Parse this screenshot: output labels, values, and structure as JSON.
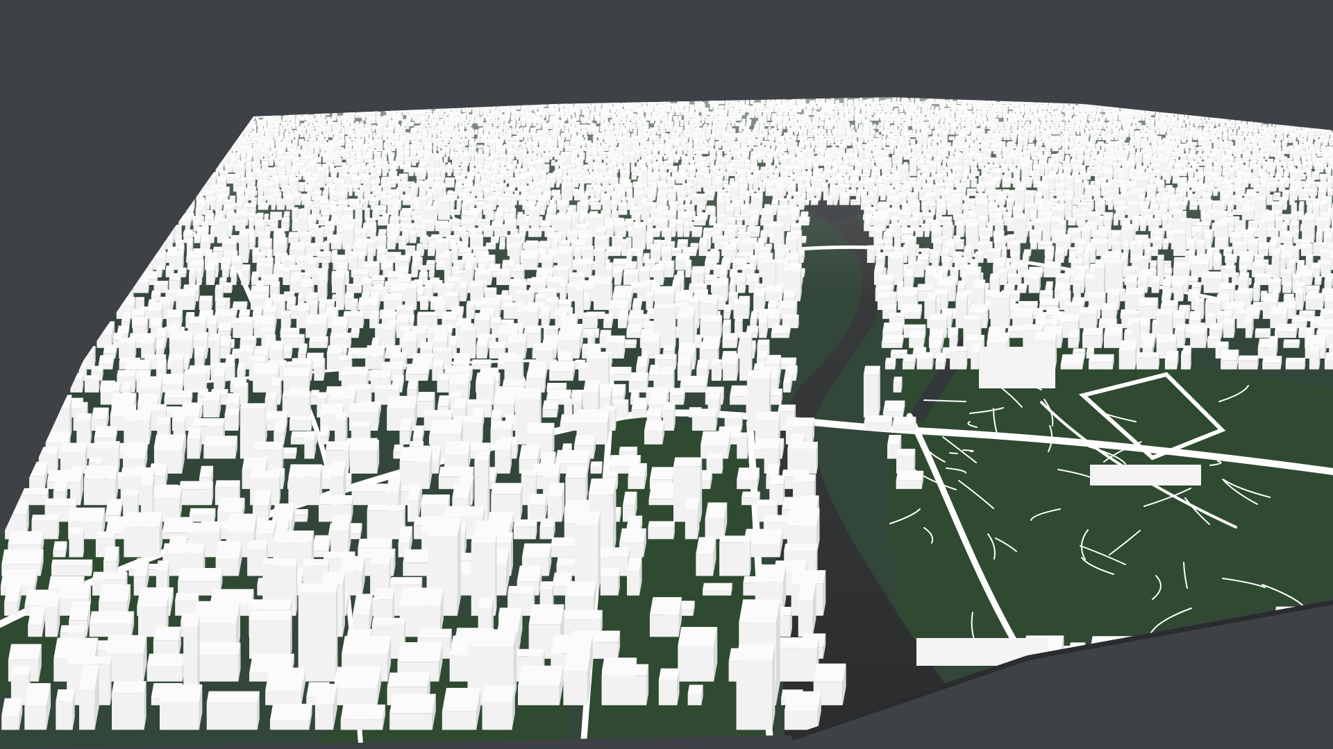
{
  "scene": {
    "type": "3d-city-model",
    "background_color": "#3e4145",
    "ground_color": "#33463a",
    "building_color": "#f2f2f2",
    "road_color": "#ffffff",
    "river_color": "#2d2f31",
    "park_color": "#2f4a30"
  }
}
